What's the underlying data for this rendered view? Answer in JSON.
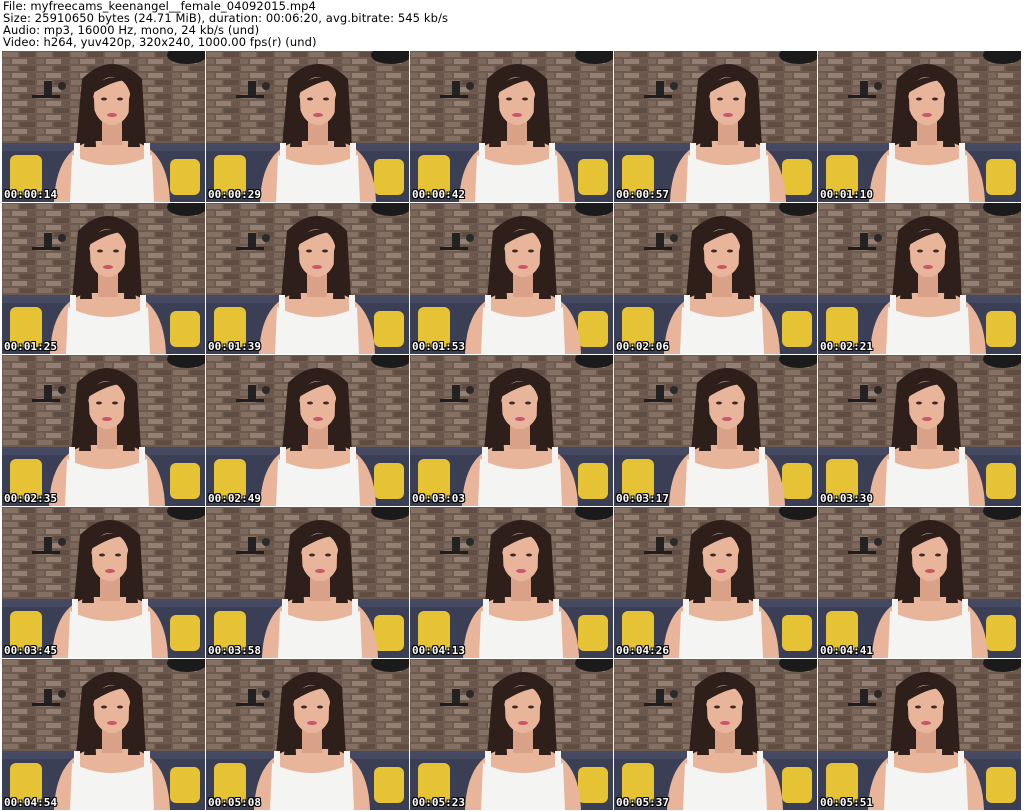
{
  "header": {
    "file_line": "File: myfreecams_keenangel__female_04092015.mp4",
    "size_line": "Size: 25910650 bytes (24.71 MiB), duration: 00:06:20, avg.bitrate: 545 kb/s",
    "audio_line": "Audio: mp3, 16000 Hz, mono, 24 kb/s (und)",
    "video_line": "Video: h264, yuv420p, 320x240, 1000.00 fps(r) (und)"
  },
  "grid": {
    "columns": 5,
    "rows": 5,
    "thumbnails": [
      {
        "timestamp": "00:00:14"
      },
      {
        "timestamp": "00:00:29"
      },
      {
        "timestamp": "00:00:42"
      },
      {
        "timestamp": "00:00:57"
      },
      {
        "timestamp": "00:01:10"
      },
      {
        "timestamp": "00:01:25"
      },
      {
        "timestamp": "00:01:39"
      },
      {
        "timestamp": "00:01:53"
      },
      {
        "timestamp": "00:02:06"
      },
      {
        "timestamp": "00:02:21"
      },
      {
        "timestamp": "00:02:35"
      },
      {
        "timestamp": "00:02:49"
      },
      {
        "timestamp": "00:03:03"
      },
      {
        "timestamp": "00:03:17"
      },
      {
        "timestamp": "00:03:30"
      },
      {
        "timestamp": "00:03:45"
      },
      {
        "timestamp": "00:03:58"
      },
      {
        "timestamp": "00:04:13"
      },
      {
        "timestamp": "00:04:26"
      },
      {
        "timestamp": "00:04:41"
      },
      {
        "timestamp": "00:04:54"
      },
      {
        "timestamp": "00:05:08"
      },
      {
        "timestamp": "00:05:23"
      },
      {
        "timestamp": "00:05:37"
      },
      {
        "timestamp": "00:05:51"
      }
    ]
  },
  "colors": {
    "background": "#ffffff",
    "brick_wall": "#6e5a4e",
    "sofa": "#3a3f55",
    "pillow": "#e6c235",
    "hair": "#2e1f1a",
    "skin": "#e8b49a",
    "top": "#f4f4f2",
    "timestamp_text": "#ffffff"
  }
}
